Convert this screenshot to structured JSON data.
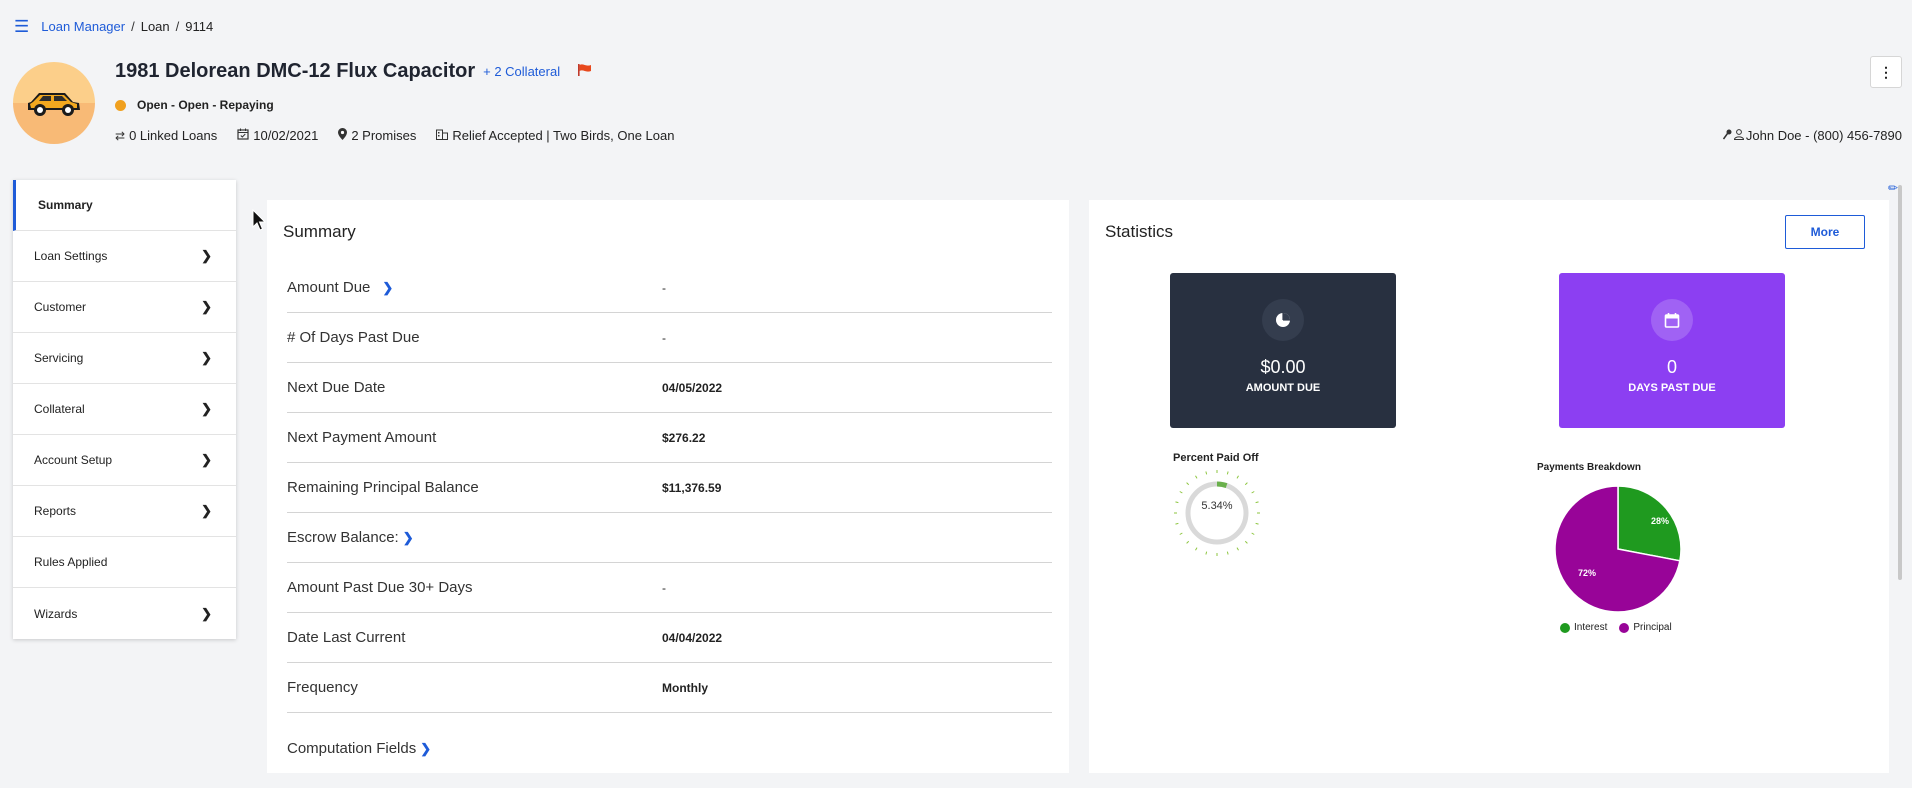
{
  "breadcrumb": {
    "menu_icon": "menu-icon",
    "items": [
      "Loan Manager",
      "Loan",
      "9114"
    ],
    "separator": "/"
  },
  "header": {
    "title": "1981 Delorean DMC-12 Flux Capacitor",
    "collateral_link": "+ 2 Collateral",
    "status": "Open - Open - Repaying",
    "status_color": "#f0a01e",
    "meta": {
      "linked_loans": "0 Linked Loans",
      "date": "10/02/2021",
      "promises": "2 Promises",
      "relief": "Relief Accepted | Two Birds, One Loan"
    },
    "contact": "John Doe - (800) 456-7890"
  },
  "nav": {
    "items": [
      {
        "label": "Summary",
        "chevron": false
      },
      {
        "label": "Loan Settings",
        "chevron": true
      },
      {
        "label": "Customer",
        "chevron": true
      },
      {
        "label": "Servicing",
        "chevron": true
      },
      {
        "label": "Collateral",
        "chevron": true
      },
      {
        "label": "Account Setup",
        "chevron": true
      },
      {
        "label": "Reports",
        "chevron": true
      },
      {
        "label": "Rules Applied",
        "chevron": false
      },
      {
        "label": "Wizards",
        "chevron": true
      }
    ]
  },
  "summary": {
    "title": "Summary",
    "rows": [
      {
        "label": "Amount Due",
        "value": "-"
      },
      {
        "label": "# Of Days Past Due",
        "value": "-"
      },
      {
        "label": "Next Due Date",
        "value": "04/05/2022"
      },
      {
        "label": "Next Payment Amount",
        "value": "$276.22"
      },
      {
        "label": "Remaining Principal Balance",
        "value": "$11,376.59"
      },
      {
        "label": "Escrow Balance:",
        "value": ""
      },
      {
        "label": "Amount Past Due 30+ Days",
        "value": "-"
      },
      {
        "label": "Date Last Current",
        "value": "04/04/2022"
      },
      {
        "label": "Frequency",
        "value": "Monthly"
      }
    ],
    "computation_fields": "Computation Fields"
  },
  "statistics": {
    "title": "Statistics",
    "more_label": "More",
    "amount_due": {
      "value": "$0.00",
      "label": "AMOUNT DUE",
      "color": "#283040"
    },
    "days_past_due": {
      "value": "0",
      "label": "DAYS PAST DUE",
      "color": "#8c3ff2"
    },
    "percent_paid_off": {
      "title": "Percent Paid Off",
      "value_text": "5.34%",
      "value": 5.34
    },
    "payments_breakdown": {
      "title": "Payments Breakdown",
      "interest_label": "Interest",
      "principal_label": "Principal",
      "interest_pct": "28%",
      "principal_pct": "72%",
      "interest_color": "#1f9a1f",
      "principal_color": "#980498"
    }
  },
  "chart_data": {
    "type": "pie",
    "title": "Payments Breakdown",
    "categories": [
      "Interest",
      "Principal"
    ],
    "values": [
      28,
      72
    ]
  }
}
